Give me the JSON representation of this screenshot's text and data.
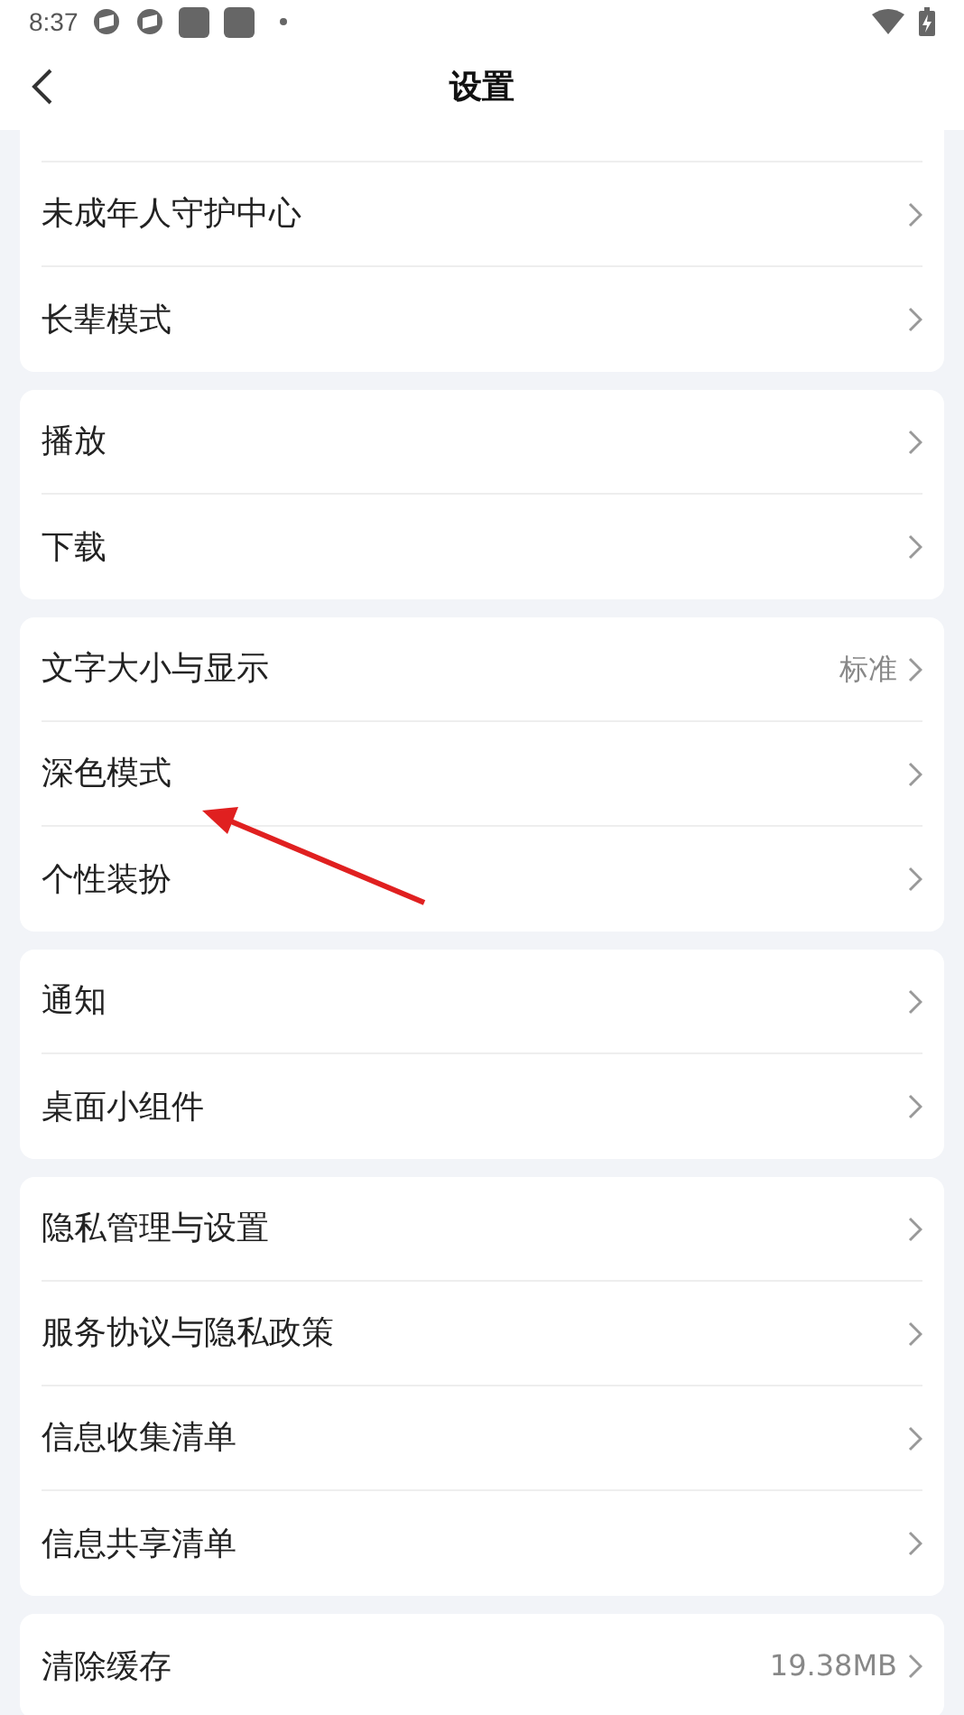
{
  "status_bar": {
    "time": "8:37"
  },
  "header": {
    "title": "设置"
  },
  "groups": [
    {
      "cut_top": true,
      "items": [
        {
          "label": "未成年人守护中心"
        },
        {
          "label": "长辈模式"
        }
      ]
    },
    {
      "items": [
        {
          "label": "播放"
        },
        {
          "label": "下载"
        }
      ]
    },
    {
      "items": [
        {
          "label": "文字大小与显示",
          "value": "标准"
        },
        {
          "label": "深色模式"
        },
        {
          "label": "个性装扮"
        }
      ]
    },
    {
      "items": [
        {
          "label": "通知"
        },
        {
          "label": "桌面小组件"
        }
      ]
    },
    {
      "items": [
        {
          "label": "隐私管理与设置"
        },
        {
          "label": "服务协议与隐私政策"
        },
        {
          "label": "信息收集清单"
        },
        {
          "label": "信息共享清单"
        }
      ]
    },
    {
      "items": [
        {
          "label": "清除缓存",
          "value": "19.38MB"
        }
      ]
    }
  ],
  "annotations": [
    {
      "kind": "arrow"
    }
  ]
}
